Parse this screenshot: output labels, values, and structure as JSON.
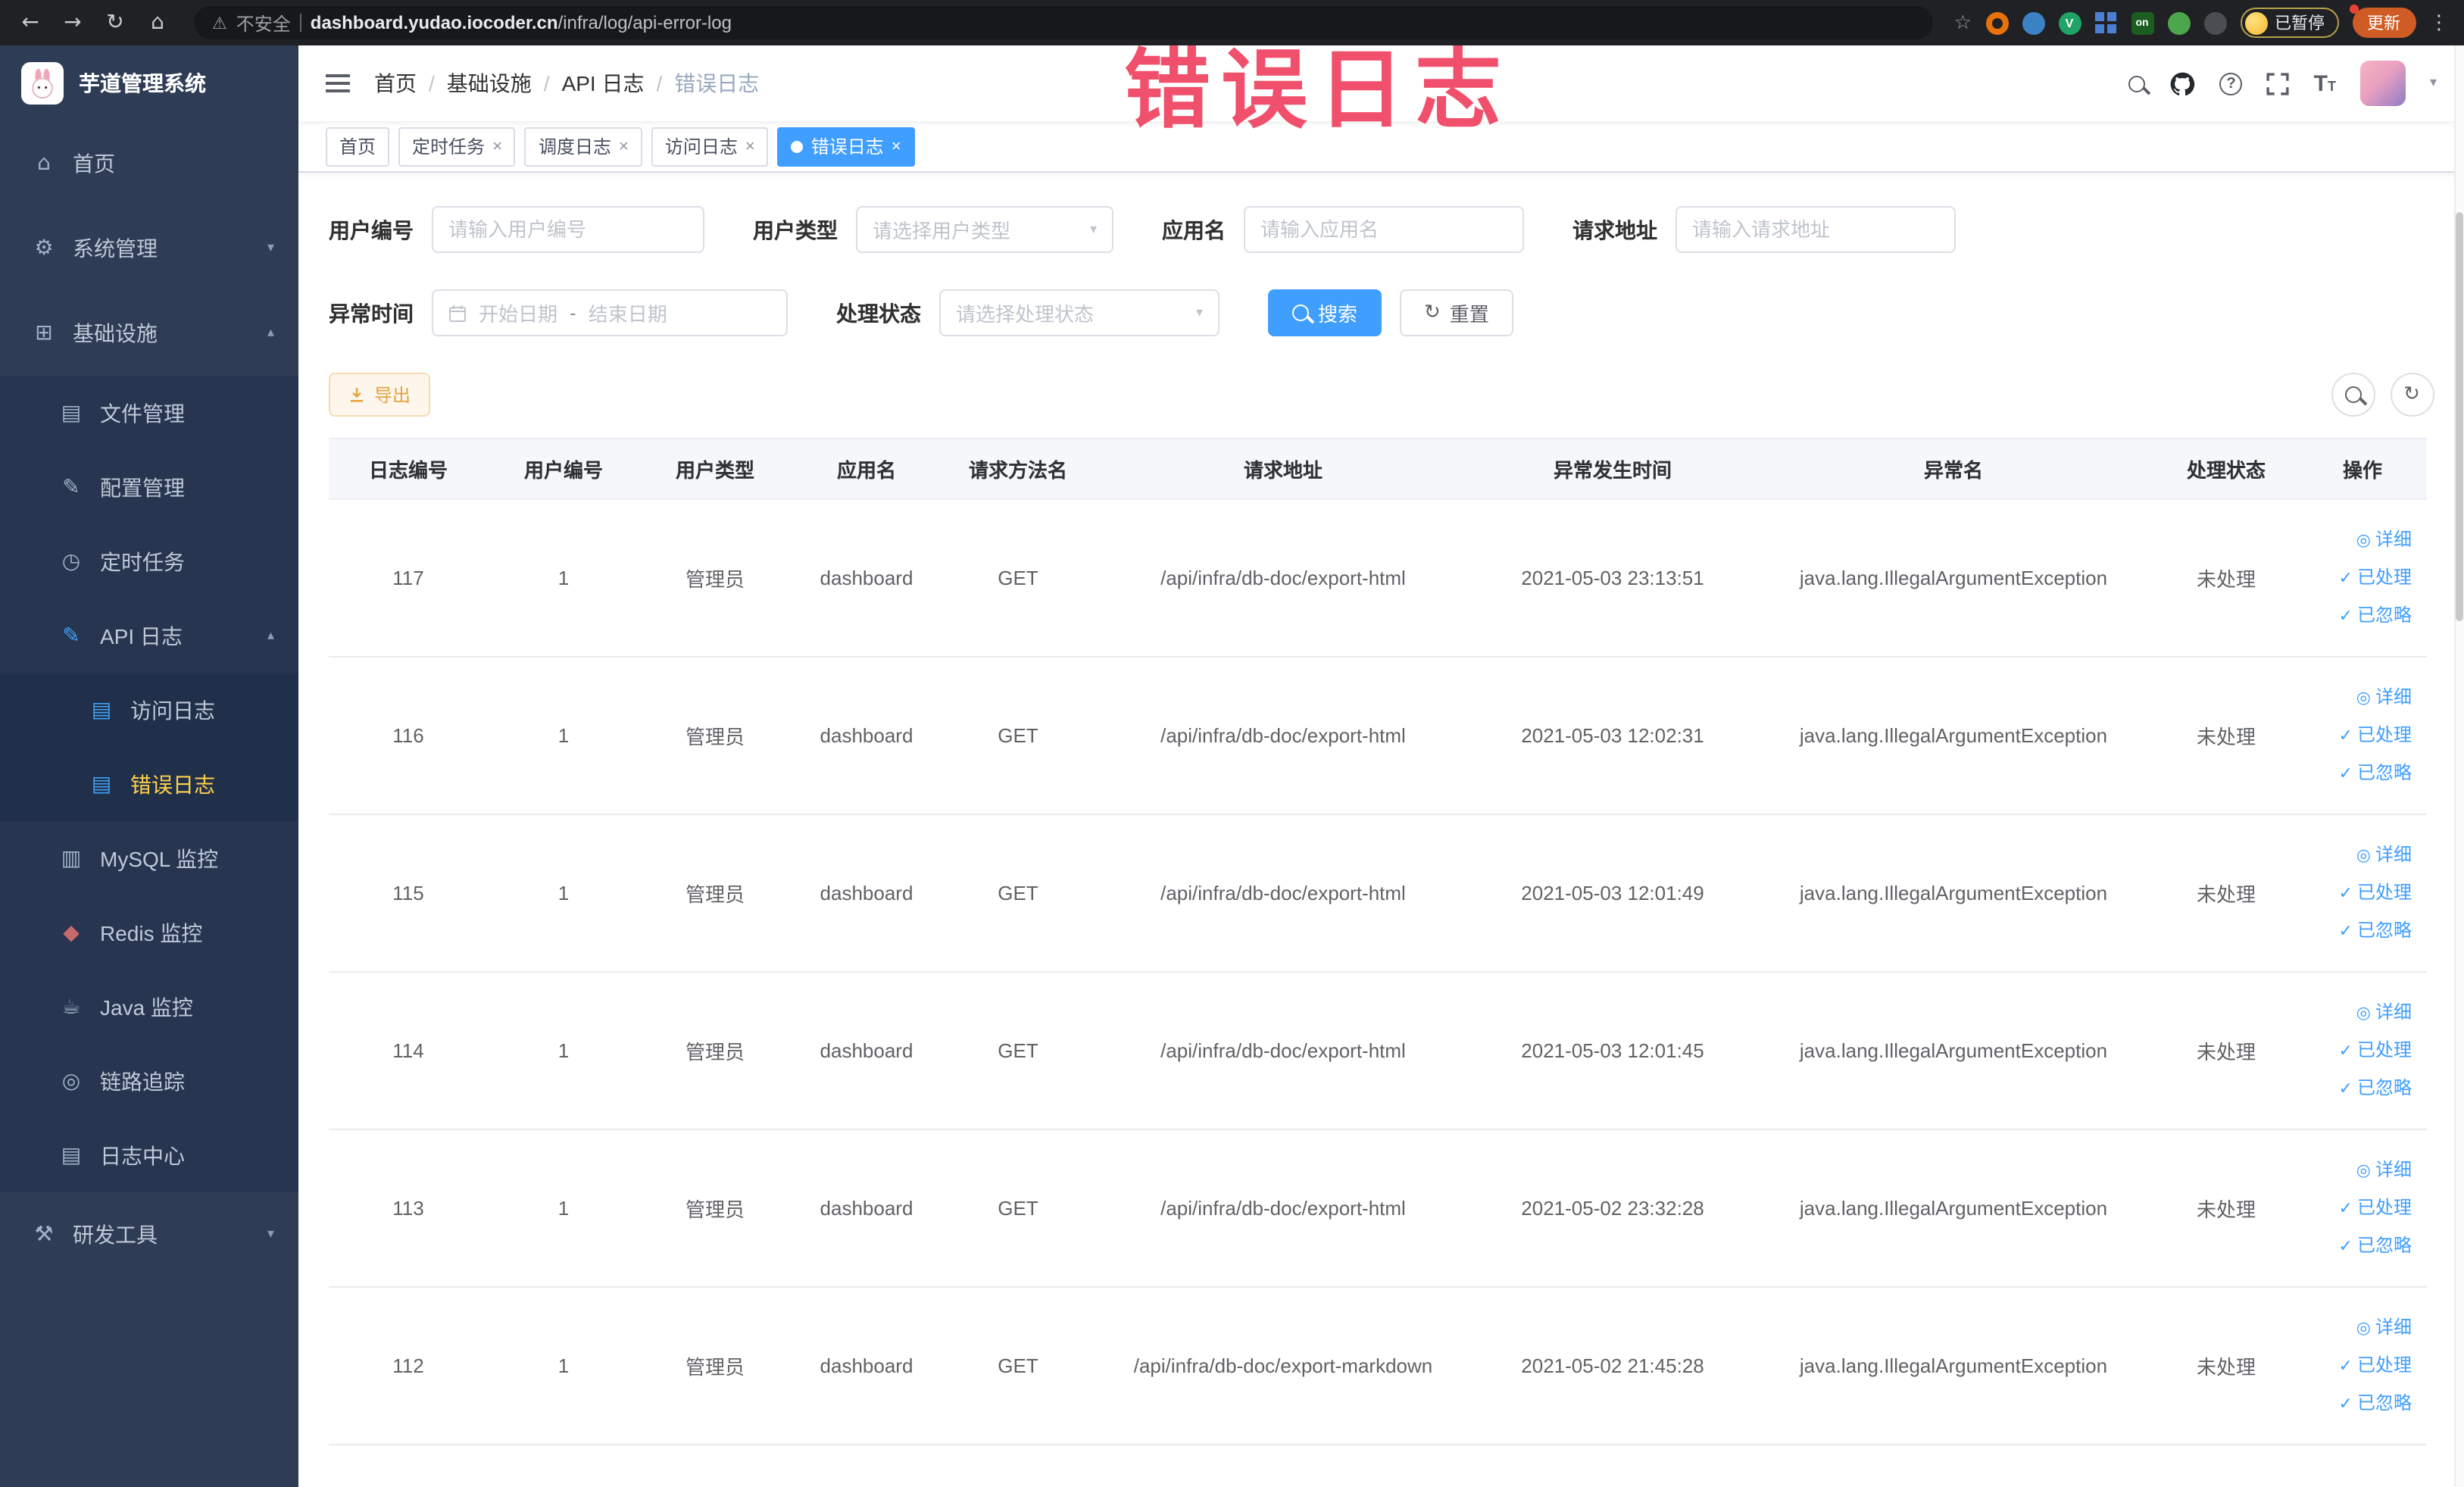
{
  "chrome": {
    "security_label": "不安全",
    "url_domain": "dashboard.yudao.iocoder.cn",
    "url_path": "/infra/log/api-error-log",
    "extension_v_badge": "V",
    "extension_on_badge": "on",
    "paused_badge": "已暂停",
    "update_button": "更新"
  },
  "sidebar": {
    "logo_title": "芋道管理系统",
    "items": [
      {
        "label": "首页"
      },
      {
        "label": "系统管理"
      },
      {
        "label": "基础设施"
      },
      {
        "label": "文件管理"
      },
      {
        "label": "配置管理"
      },
      {
        "label": "定时任务"
      },
      {
        "label": "API 日志"
      },
      {
        "label": "访问日志"
      },
      {
        "label": "错误日志"
      },
      {
        "label": "MySQL 监控"
      },
      {
        "label": "Redis 监控"
      },
      {
        "label": "Java 监控"
      },
      {
        "label": "链路追踪"
      },
      {
        "label": "日志中心"
      },
      {
        "label": "研发工具"
      }
    ]
  },
  "navbar": {
    "breadcrumb": [
      "首页",
      "基础设施",
      "API 日志",
      "错误日志"
    ]
  },
  "tabs": [
    {
      "label": "首页"
    },
    {
      "label": "定时任务"
    },
    {
      "label": "调度日志"
    },
    {
      "label": "访问日志"
    },
    {
      "label": "错误日志"
    }
  ],
  "annotation": {
    "text": "错误日志"
  },
  "filters": {
    "user_id_label": "用户编号",
    "user_id_placeholder": "请输入用户编号",
    "user_type_label": "用户类型",
    "user_type_placeholder": "请选择用户类型",
    "app_name_label": "应用名",
    "app_name_placeholder": "请输入应用名",
    "request_url_label": "请求地址",
    "request_url_placeholder": "请输入请求地址",
    "time_label": "异常时间",
    "time_start_placeholder": "开始日期",
    "time_separator": "-",
    "time_end_placeholder": "结束日期",
    "status_label": "处理状态",
    "status_placeholder": "请选择处理状态",
    "search_label": "搜索",
    "reset_label": "重置"
  },
  "toolbar": {
    "export_label": "导出"
  },
  "table": {
    "columns": [
      "日志编号",
      "用户编号",
      "用户类型",
      "应用名",
      "请求方法名",
      "请求地址",
      "异常发生时间",
      "异常名",
      "处理状态",
      "操作"
    ],
    "action_labels": {
      "detail": "详细",
      "process": "已处理",
      "ignore": "已忽略"
    },
    "rows": [
      {
        "log_id": "117",
        "user_id": "1",
        "user_type": "管理员",
        "app_name": "dashboard",
        "method": "GET",
        "request_url": "/api/infra/db-doc/export-html",
        "time": "2021-05-03 23:13:51",
        "exception": "java.lang.IllegalArgumentException",
        "status": "未处理"
      },
      {
        "log_id": "116",
        "user_id": "1",
        "user_type": "管理员",
        "app_name": "dashboard",
        "method": "GET",
        "request_url": "/api/infra/db-doc/export-html",
        "time": "2021-05-03 12:02:31",
        "exception": "java.lang.IllegalArgumentException",
        "status": "未处理"
      },
      {
        "log_id": "115",
        "user_id": "1",
        "user_type": "管理员",
        "app_name": "dashboard",
        "method": "GET",
        "request_url": "/api/infra/db-doc/export-html",
        "time": "2021-05-03 12:01:49",
        "exception": "java.lang.IllegalArgumentException",
        "status": "未处理"
      },
      {
        "log_id": "114",
        "user_id": "1",
        "user_type": "管理员",
        "app_name": "dashboard",
        "method": "GET",
        "request_url": "/api/infra/db-doc/export-html",
        "time": "2021-05-03 12:01:45",
        "exception": "java.lang.IllegalArgumentException",
        "status": "未处理"
      },
      {
        "log_id": "113",
        "user_id": "1",
        "user_type": "管理员",
        "app_name": "dashboard",
        "method": "GET",
        "request_url": "/api/infra/db-doc/export-html",
        "time": "2021-05-02 23:32:28",
        "exception": "java.lang.IllegalArgumentException",
        "status": "未处理"
      },
      {
        "log_id": "112",
        "user_id": "1",
        "user_type": "管理员",
        "app_name": "dashboard",
        "method": "GET",
        "request_url": "/api/infra/db-doc/export-markdown",
        "time": "2021-05-02 21:45:28",
        "exception": "java.lang.IllegalArgumentException",
        "status": "未处理"
      }
    ]
  }
}
